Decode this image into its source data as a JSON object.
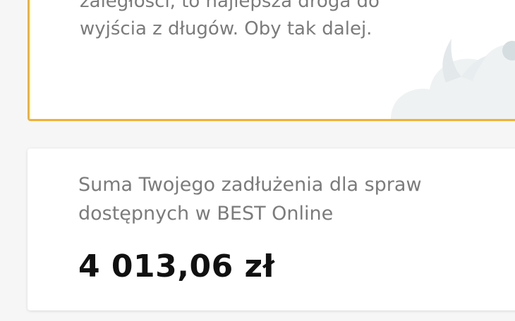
{
  "top_card": {
    "message_line_1": "zaległości, to najlepsza droga do",
    "message_line_2": "wyjścia z długów. Oby tak dalej."
  },
  "debt_card": {
    "label": "Suma Twojego zadłużenia dla spraw dostępnych w BEST Online",
    "amount": "4 013,06 zł"
  },
  "colors": {
    "accent_border": "#f2b134",
    "text_muted": "#7b7b7b",
    "text_strong": "#111111"
  }
}
